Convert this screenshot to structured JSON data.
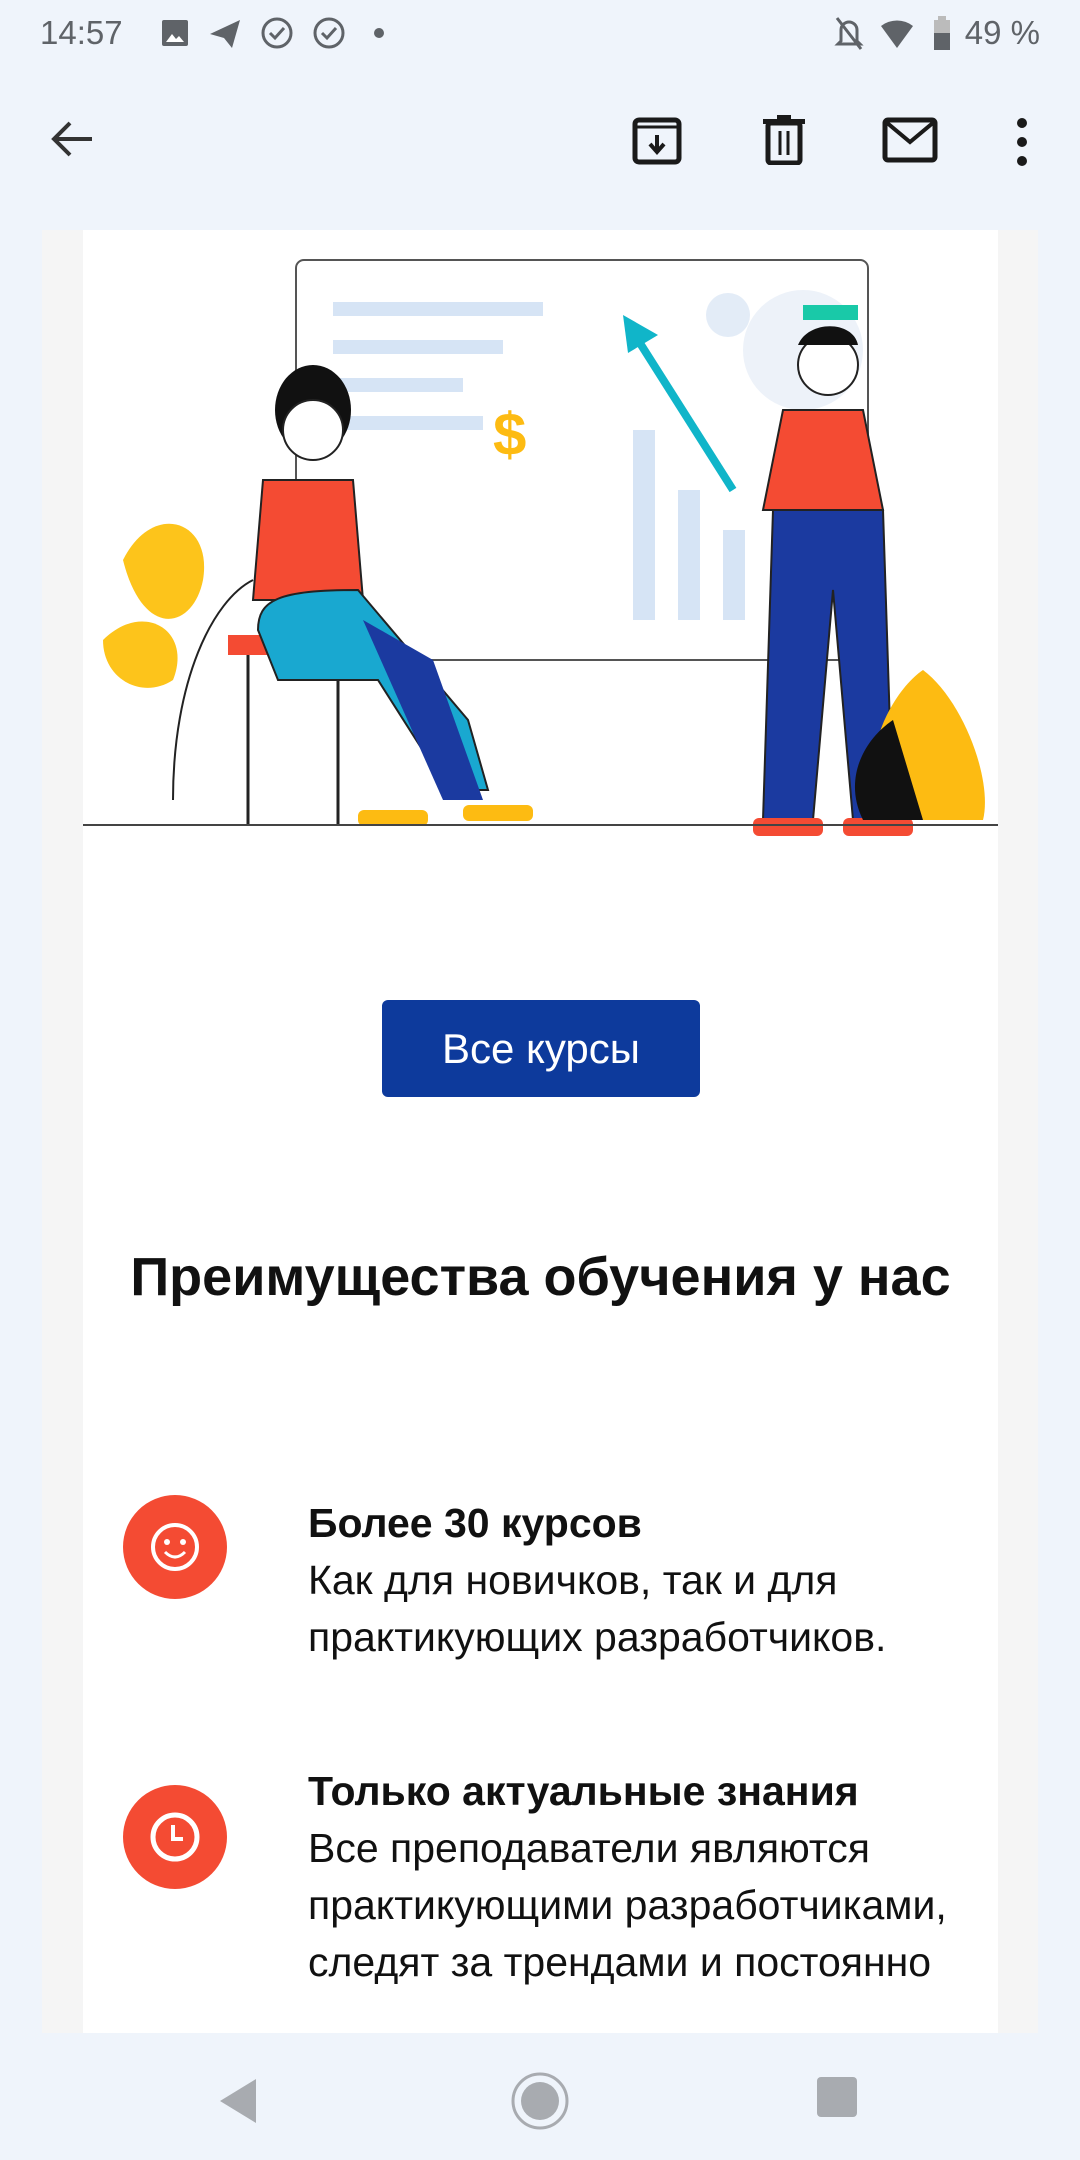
{
  "status_bar": {
    "time": "14:57",
    "battery": "49 %",
    "icons": [
      "image-icon",
      "telegram-icon",
      "check-circle-icon",
      "check-circle-icon",
      "dot-icon",
      "bell-off-icon",
      "wifi-icon",
      "battery-icon"
    ]
  },
  "toolbar": {
    "icons": [
      "back-arrow-icon",
      "archive-icon",
      "delete-icon",
      "mark-unread-icon",
      "more-vert-icon"
    ]
  },
  "email": {
    "button_label": "Все курсы",
    "button_color": "#0d3a9c",
    "heading": "Преимущества обучения у нас",
    "features": [
      {
        "icon": "smile-icon",
        "title": "Более 30 курсов",
        "body": "Как для новичков, так и для практикующих разработчиков."
      },
      {
        "icon": "clock-icon",
        "title": "Только актуальные знания",
        "body": "Все преподаватели являются практикующими разработчиками, следят за трендами и постоянно"
      }
    ],
    "accent_color": "#f44b33"
  },
  "nav_bar": {
    "icons": [
      "nav-back-icon",
      "nav-home-icon",
      "nav-recents-icon"
    ]
  }
}
